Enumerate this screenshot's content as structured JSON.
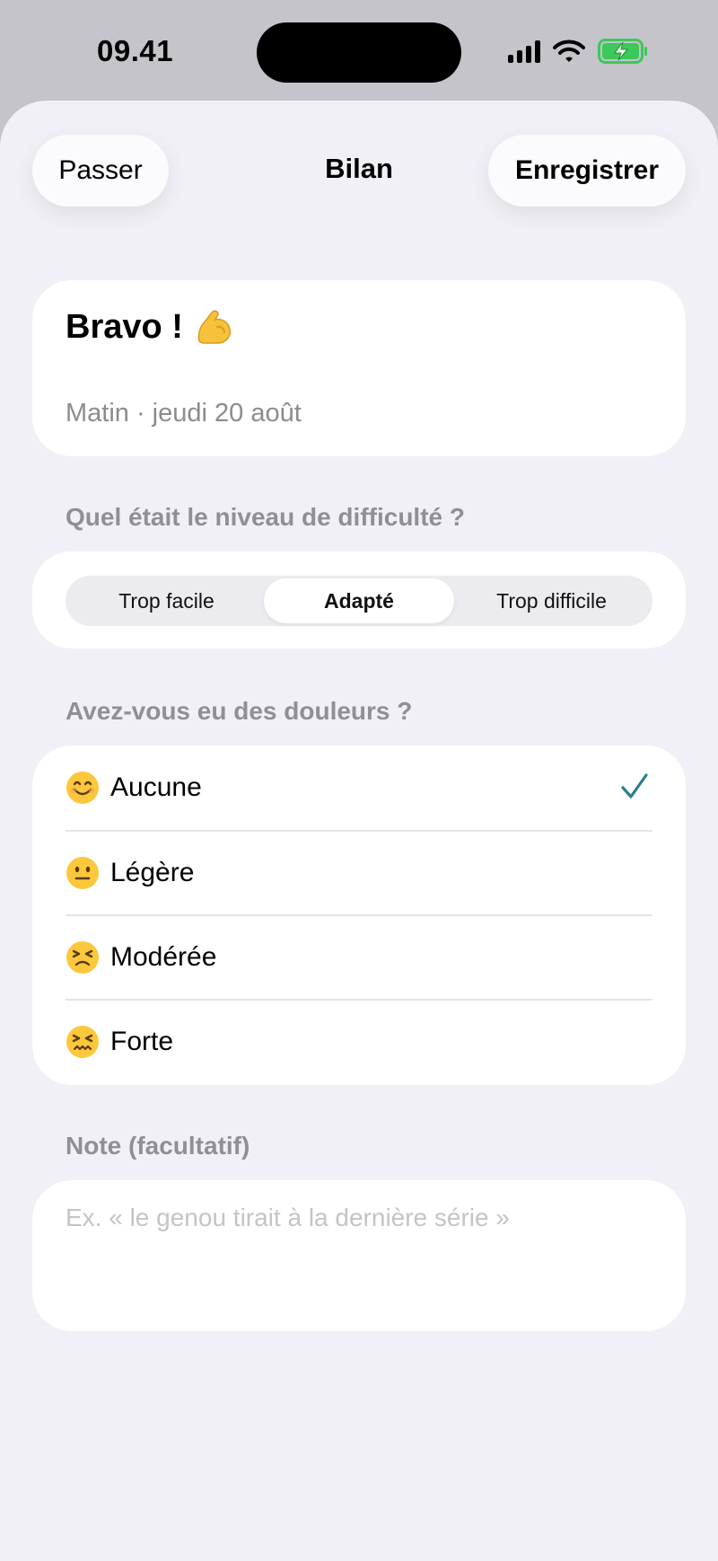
{
  "status_bar": {
    "time": "09.41"
  },
  "nav": {
    "skip_label": "Passer",
    "title": "Bilan",
    "save_label": "Enregistrer"
  },
  "hero": {
    "title": "Bravo !",
    "icon": "flexed-biceps-icon",
    "subtitle": "Matin · jeudi 20 août"
  },
  "difficulty": {
    "question": "Quel était le niveau de difficulté ?",
    "options": [
      "Trop facile",
      "Adapté",
      "Trop difficile"
    ],
    "selected": "Adapté"
  },
  "pain": {
    "question": "Avez-vous eu des douleurs ?",
    "options": [
      {
        "label": "Aucune",
        "icon": "smiling-face-icon",
        "selected": true
      },
      {
        "label": "Légère",
        "icon": "neutral-face-icon",
        "selected": false
      },
      {
        "label": "Modérée",
        "icon": "persevering-face-icon",
        "selected": false
      },
      {
        "label": "Forte",
        "icon": "confounded-face-icon",
        "selected": false
      }
    ]
  },
  "note": {
    "label": "Note (facultatif)",
    "placeholder": "Ex. « le genou tirait à la dernière série »",
    "value": ""
  },
  "colors": {
    "accent": "#2a7f8e",
    "background": "#f0f0f6",
    "secondary_text": "#8b8b90"
  }
}
